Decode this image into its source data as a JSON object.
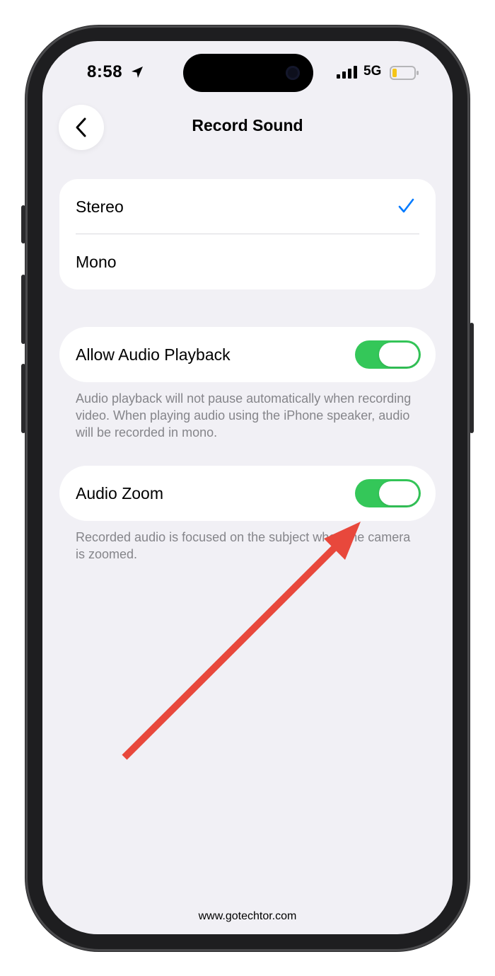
{
  "status_bar": {
    "time": "8:58",
    "network": "5G"
  },
  "nav": {
    "title": "Record Sound"
  },
  "sound_options": [
    {
      "label": "Stereo",
      "selected": true
    },
    {
      "label": "Mono",
      "selected": false
    }
  ],
  "allow_audio_playback": {
    "label": "Allow Audio Playback",
    "enabled": true,
    "footnote": "Audio playback will not pause automatically when recording video. When playing audio using the iPhone speaker, audio will be recorded in mono."
  },
  "audio_zoom": {
    "label": "Audio Zoom",
    "enabled": true,
    "footnote": "Recorded audio is focused on the subject when the camera is zoomed."
  },
  "watermark": "www.gotechtor.com",
  "colors": {
    "toggle_on": "#34c759",
    "checkmark": "#007aff",
    "arrow": "#e8483c",
    "background": "#f1f0f5"
  }
}
